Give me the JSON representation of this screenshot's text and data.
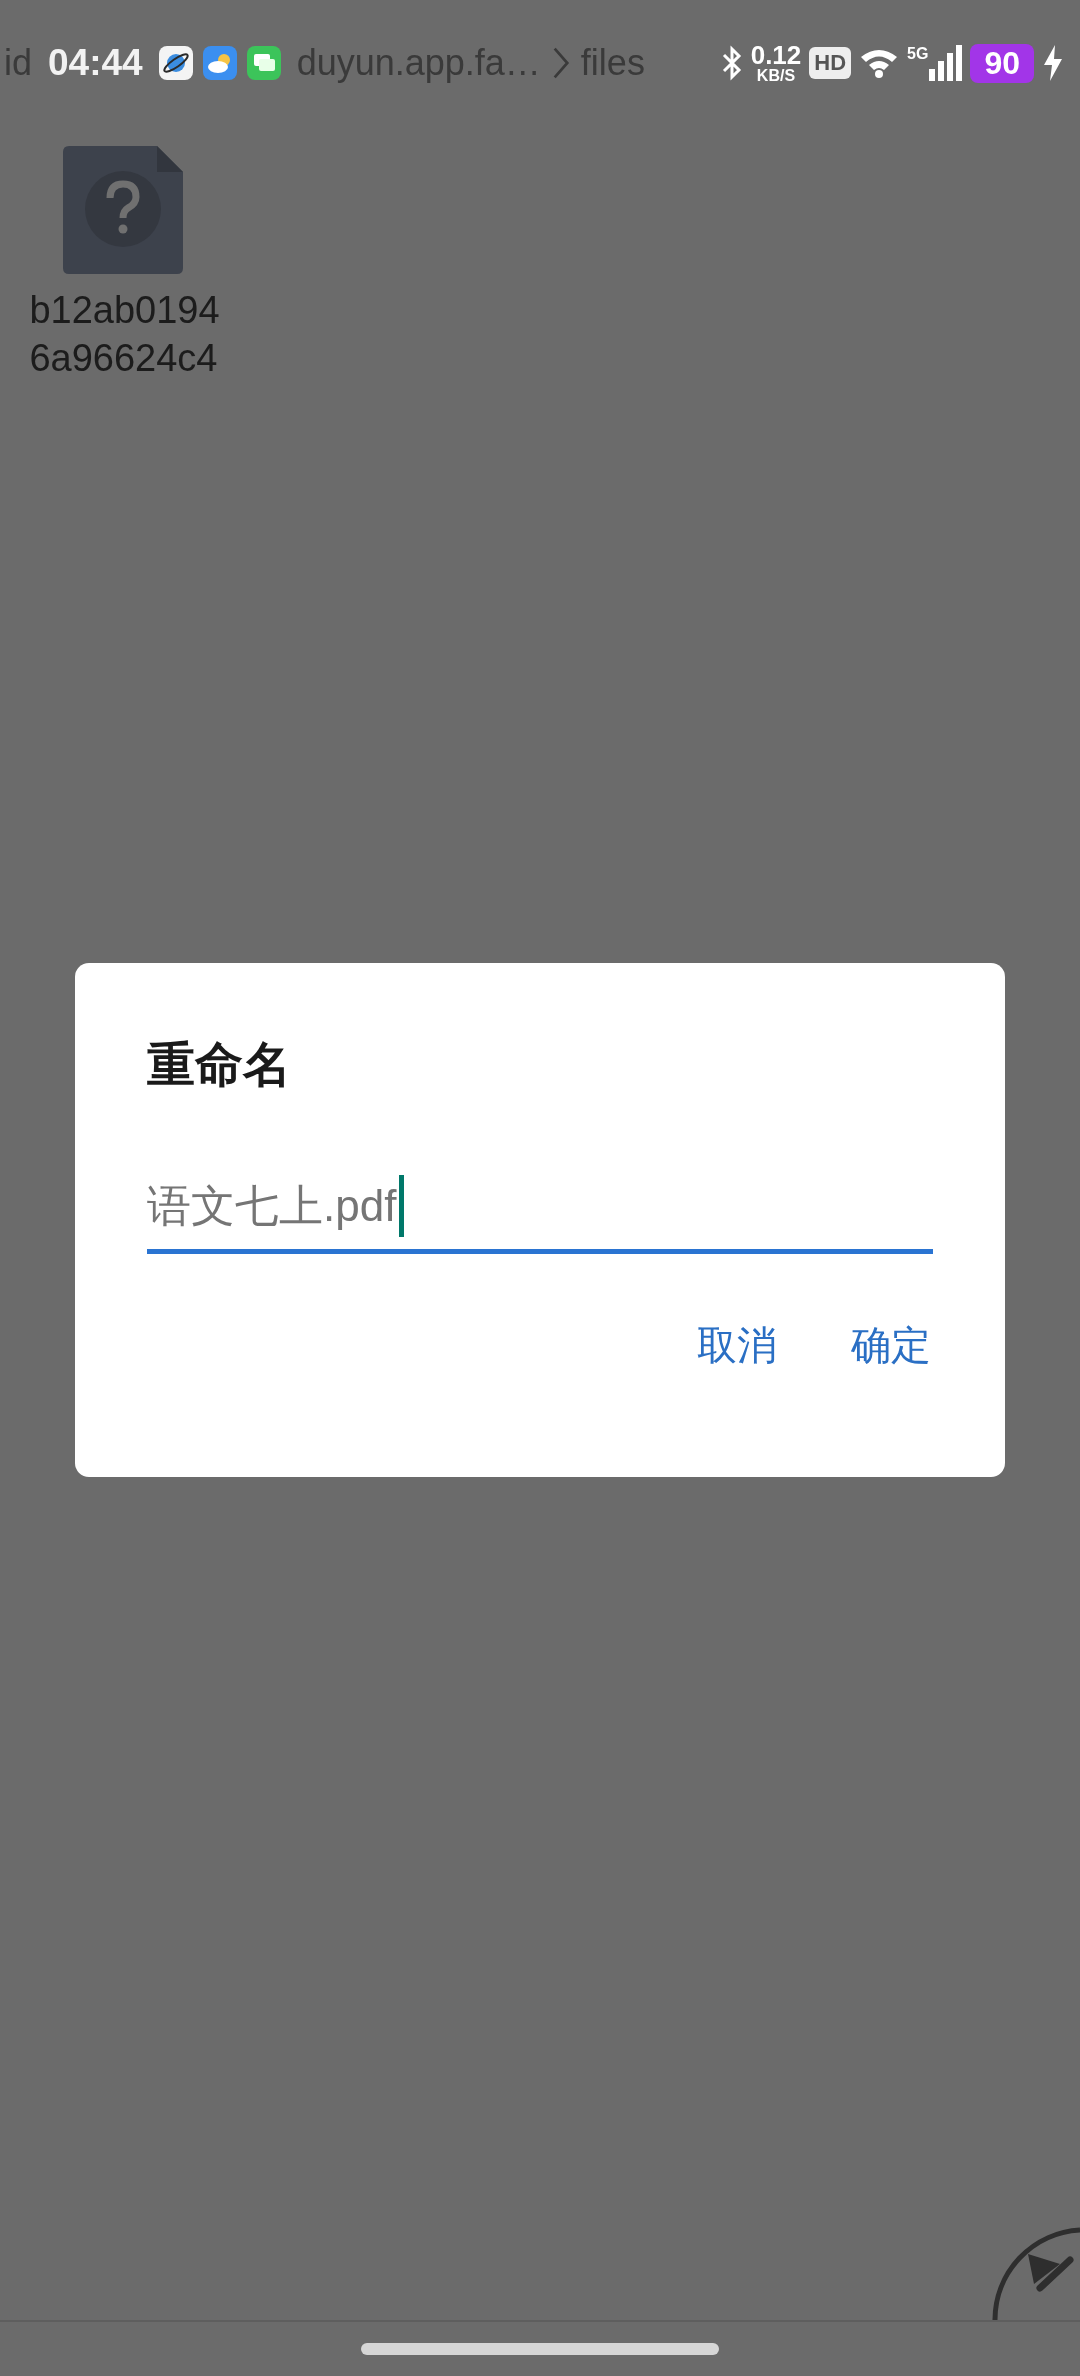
{
  "breadcrumb": [
    "id",
    "duyun.app.fa…",
    "files"
  ],
  "status_bar": {
    "time": "04:44",
    "speed": "0.12",
    "speed_unit": "KB/S",
    "hd": "HD",
    "network": "5G",
    "battery": "90",
    "charging": true
  },
  "files": [
    {
      "name_lines": [
        "b12ab0194",
        "6a96624c4"
      ]
    }
  ],
  "dialog": {
    "title": "重命名",
    "field": {
      "value": "语文七上.pdf",
      "focused": true
    },
    "buttons": [
      "取消",
      "确定"
    ]
  }
}
